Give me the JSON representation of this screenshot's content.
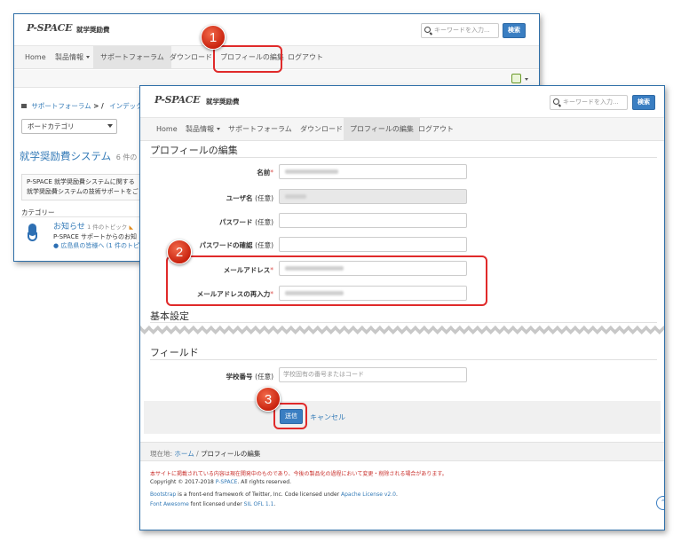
{
  "site": {
    "logo": "P-SPACE",
    "logo_sub": "就学奨励費",
    "search_placeholder": "キーワードを入力...",
    "search_button": "検索"
  },
  "nav": {
    "home": "Home",
    "products": "製品情報",
    "forum": "サポートフォーラム",
    "download": "ダウンロード",
    "profile_edit": "プロフィールの編集",
    "logout": "ログアウト"
  },
  "back_window": {
    "breadcrumb_forum": "サポートフォーラム",
    "breadcrumb_next": "インデック",
    "board_select": "ボードカテゴリ",
    "title": "就学奨励費システム",
    "title_count": "6 件のト",
    "desc_line1": "P-SPACE 就学奨励費システムに関する",
    "desc_line2": "就学奨励費システムの技術サポートをご",
    "category_label": "カテゴリー",
    "topic_title": "お知らせ",
    "topic_count": "1 件のトピック",
    "topic_desc": "P-SPACE サポートからのお知",
    "topic_sub": "広島県の皆様へ (1 件のトピック"
  },
  "form": {
    "heading": "プロフィールの編集",
    "name_label": "名前",
    "username_label": "ユーザ名",
    "password_label": "パスワード",
    "password_confirm_label": "パスワードの確認",
    "email_label": "メールアドレス",
    "email_confirm_label": "メールアドレスの再入力",
    "optional": "(任意)",
    "required_mark": "*",
    "basic_settings": "基本設定",
    "fields_heading": "フィールド",
    "school_no_label": "学校番号",
    "school_no_placeholder": "学校固有の番号またはコード",
    "submit": "送信",
    "cancel": "キャンセル"
  },
  "footer": {
    "breadcrumb_prefix": "現在地:",
    "breadcrumb_home": "ホーム",
    "breadcrumb_current": "プロフィールの編集",
    "notice": "本サイトに掲載されている内容は現在開発中のものであり、今後の製品化の過程において変更・削除される場合があります。",
    "copyright_prefix": "Copyright © 2017-2018",
    "copyright_link": "P-SPACE",
    "copyright_suffix": ". All rights reserved.",
    "bootstrap_link": "Bootstrap",
    "bootstrap_text": " is a front-end framework of Twitter, Inc. Code licensed under ",
    "apache_link": "Apache License v2.0",
    "fa_link": "Font Awesome",
    "fa_text": " font licensed under ",
    "ofl_link": "SIL OFL 1.1"
  },
  "callouts": [
    "1",
    "2",
    "3"
  ],
  "colors": {
    "accent": "#3a7ec2",
    "callout": "#d9341a",
    "highlight": "#e02a2a",
    "notice": "#c9302c"
  }
}
